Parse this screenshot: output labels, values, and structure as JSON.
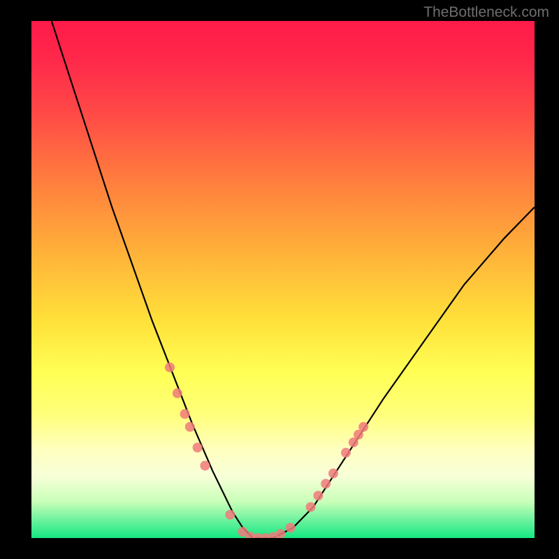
{
  "watermark": "TheBottleneck.com",
  "chart_data": {
    "type": "line",
    "title": "",
    "xlabel": "",
    "ylabel": "",
    "xlim": [
      0,
      100
    ],
    "ylim": [
      0,
      100
    ],
    "grid": false,
    "legend": false,
    "background_gradient": {
      "top": "#ff1a4a",
      "mid_upper": "#ffb23a",
      "mid": "#ffff55",
      "mid_lower": "#c8ffb8",
      "bottom": "#15e882"
    },
    "series": [
      {
        "name": "bottleneck-curve",
        "color": "#000000",
        "x": [
          4,
          8,
          12,
          16,
          20,
          24,
          28,
          32,
          36,
          38,
          40,
          42,
          44,
          46,
          48,
          52,
          56,
          60,
          64,
          70,
          78,
          86,
          94,
          100
        ],
        "y": [
          100,
          88,
          76,
          64,
          53,
          42,
          32,
          22,
          13,
          9,
          5,
          2,
          0,
          0,
          0,
          2,
          6,
          12,
          18,
          27,
          38,
          49,
          58,
          64
        ]
      }
    ],
    "scatter_points": {
      "name": "highlighted-points",
      "color": "#f07a7a",
      "radius": 7,
      "points": [
        {
          "x": 27.5,
          "y": 33
        },
        {
          "x": 29.0,
          "y": 28
        },
        {
          "x": 30.5,
          "y": 24
        },
        {
          "x": 31.5,
          "y": 21.5
        },
        {
          "x": 33.0,
          "y": 17.5
        },
        {
          "x": 34.5,
          "y": 14
        },
        {
          "x": 39.5,
          "y": 4.5
        },
        {
          "x": 42.0,
          "y": 1.2
        },
        {
          "x": 43.5,
          "y": 0.3
        },
        {
          "x": 45.0,
          "y": 0
        },
        {
          "x": 46.5,
          "y": 0
        },
        {
          "x": 48.0,
          "y": 0.2
        },
        {
          "x": 49.5,
          "y": 0.8
        },
        {
          "x": 51.5,
          "y": 2.0
        },
        {
          "x": 55.5,
          "y": 6.0
        },
        {
          "x": 57.0,
          "y": 8.2
        },
        {
          "x": 58.5,
          "y": 10.5
        },
        {
          "x": 60.0,
          "y": 12.5
        },
        {
          "x": 62.5,
          "y": 16.5
        },
        {
          "x": 64.0,
          "y": 18.5
        },
        {
          "x": 65.0,
          "y": 20.0
        },
        {
          "x": 66.0,
          "y": 21.5
        }
      ]
    }
  }
}
